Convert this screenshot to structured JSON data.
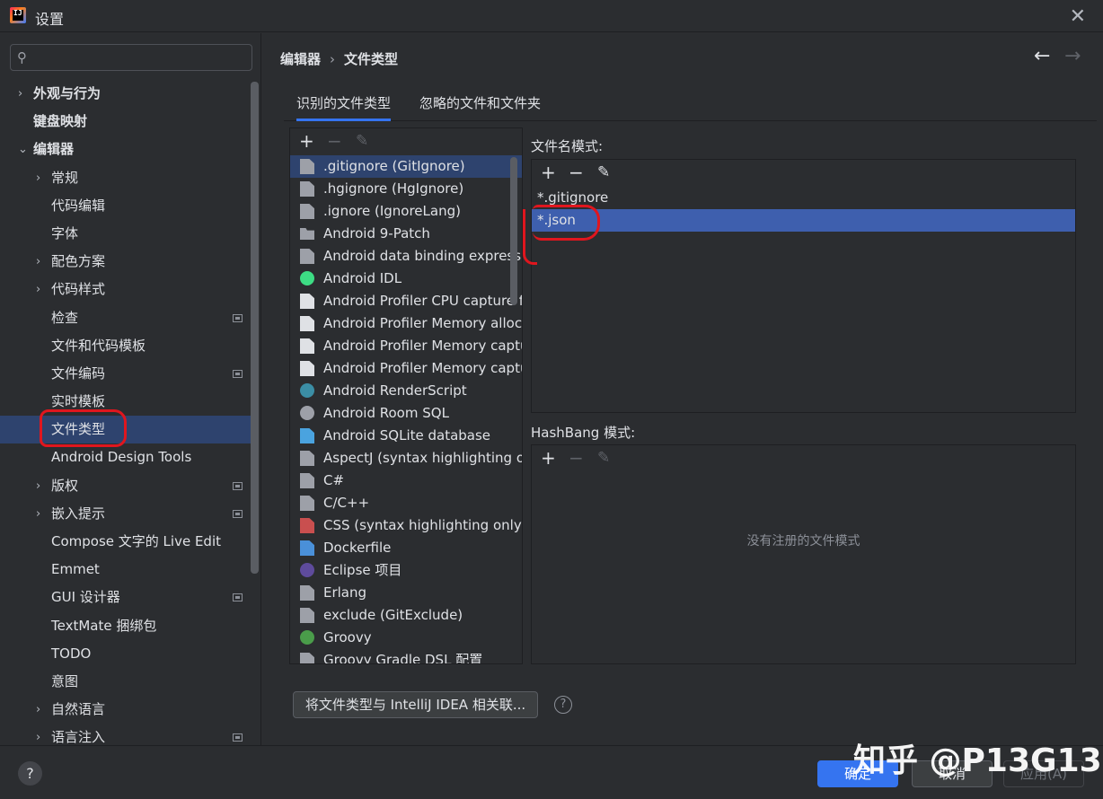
{
  "window": {
    "title": "设置",
    "app_icon": "intellij-icon"
  },
  "search": {
    "placeholder": ""
  },
  "sidebar": {
    "items": [
      {
        "label": "外观与行为",
        "level": 0,
        "chevron": "›",
        "bold": true
      },
      {
        "label": "键盘映射",
        "level": 0,
        "chevron": "",
        "bold": true
      },
      {
        "label": "编辑器",
        "level": 0,
        "chevron": "⌄",
        "bold": true
      },
      {
        "label": "常规",
        "level": 1,
        "chevron": "›"
      },
      {
        "label": "代码编辑",
        "level": 1,
        "chevron": ""
      },
      {
        "label": "字体",
        "level": 1,
        "chevron": ""
      },
      {
        "label": "配色方案",
        "level": 1,
        "chevron": "›"
      },
      {
        "label": "代码样式",
        "level": 1,
        "chevron": "›"
      },
      {
        "label": "检查",
        "level": 1,
        "chevron": "",
        "badge": true
      },
      {
        "label": "文件和代码模板",
        "level": 1,
        "chevron": ""
      },
      {
        "label": "文件编码",
        "level": 1,
        "chevron": "",
        "badge": true
      },
      {
        "label": "实时模板",
        "level": 1,
        "chevron": ""
      },
      {
        "label": "文件类型",
        "level": 1,
        "chevron": "",
        "selected": true
      },
      {
        "label": "Android Design Tools",
        "level": 1,
        "chevron": ""
      },
      {
        "label": "版权",
        "level": 1,
        "chevron": "›",
        "badge": true
      },
      {
        "label": "嵌入提示",
        "level": 1,
        "chevron": "›",
        "badge": true
      },
      {
        "label": "Compose 文字的 Live Edit",
        "level": 1,
        "chevron": ""
      },
      {
        "label": "Emmet",
        "level": 1,
        "chevron": ""
      },
      {
        "label": "GUI 设计器",
        "level": 1,
        "chevron": "",
        "badge": true
      },
      {
        "label": "TextMate 捆绑包",
        "level": 1,
        "chevron": ""
      },
      {
        "label": "TODO",
        "level": 1,
        "chevron": ""
      },
      {
        "label": "意图",
        "level": 1,
        "chevron": ""
      },
      {
        "label": "自然语言",
        "level": 1,
        "chevron": "›"
      },
      {
        "label": "语言注入",
        "level": 1,
        "chevron": "›",
        "badge": true
      }
    ]
  },
  "breadcrumb": {
    "parent": "编辑器",
    "separator": "›",
    "current": "文件类型"
  },
  "nav": {
    "back": "←",
    "forward": "→"
  },
  "tabs": [
    {
      "label": "识别的文件类型",
      "active": true
    },
    {
      "label": "忽略的文件和文件夹",
      "active": false
    }
  ],
  "toolbar": {
    "add": "+",
    "remove": "−",
    "edit": "✎"
  },
  "file_types": [
    {
      "name": ".gitignore (GitIgnore)",
      "icon": "file-icon",
      "ic": "file",
      "selected": true
    },
    {
      "name": ".hgignore (HgIgnore)",
      "icon": "file-icon",
      "ic": "file"
    },
    {
      "name": ".ignore (IgnoreLang)",
      "icon": "file-icon",
      "ic": "file"
    },
    {
      "name": "Android 9-Patch",
      "icon": "folder-icon",
      "ic": "folder"
    },
    {
      "name": "Android data binding expressio",
      "icon": "file-icon",
      "ic": "file"
    },
    {
      "name": "Android IDL",
      "icon": "android-icon",
      "ic": "round",
      "color": "#3ddc84"
    },
    {
      "name": "Android Profiler CPU capture fi",
      "icon": "profiler-file-icon",
      "ic": "fileb"
    },
    {
      "name": "Android Profiler Memory alloc",
      "icon": "profiler-file-icon",
      "ic": "fileb"
    },
    {
      "name": "Android Profiler Memory captu",
      "icon": "profiler-file-icon",
      "ic": "fileb"
    },
    {
      "name": "Android Profiler Memory captu",
      "icon": "profiler-file-icon",
      "ic": "fileb"
    },
    {
      "name": "Android RenderScript",
      "icon": "renderscript-icon",
      "ic": "round",
      "color": "#3b8ea5"
    },
    {
      "name": "Android Room SQL",
      "icon": "database-icon",
      "ic": "round",
      "color": "#9da0a8"
    },
    {
      "name": "Android SQLite database",
      "icon": "sqlite-icon",
      "ic": "fileb",
      "color": "#4aa3df"
    },
    {
      "name": "AspectJ (syntax highlighting or",
      "icon": "file-icon",
      "ic": "file"
    },
    {
      "name": "C#",
      "icon": "file-icon",
      "ic": "file"
    },
    {
      "name": "C/C++",
      "icon": "file-icon",
      "ic": "file"
    },
    {
      "name": "CSS (syntax highlighting only)",
      "icon": "css-icon",
      "ic": "fileb",
      "color": "#c94f4f"
    },
    {
      "name": "Dockerfile",
      "icon": "docker-file-icon",
      "ic": "fileb",
      "color": "#4a90d9"
    },
    {
      "name": "Eclipse 项目",
      "icon": "eclipse-icon",
      "ic": "round",
      "color": "#5e4b9c"
    },
    {
      "name": "Erlang",
      "icon": "file-icon",
      "ic": "file"
    },
    {
      "name": "exclude (GitExclude)",
      "icon": "file-icon",
      "ic": "file"
    },
    {
      "name": "Groovy",
      "icon": "groovy-icon",
      "ic": "round",
      "color": "#4a9c4a"
    },
    {
      "name": "Groovy Gradle DSL 配置",
      "icon": "gradle-icon",
      "ic": "file"
    }
  ],
  "file_name_patterns": {
    "label": "文件名模式:",
    "items": [
      {
        "value": "*.gitignore",
        "selected": false
      },
      {
        "value": "*.json",
        "selected": true
      }
    ]
  },
  "hashbang_patterns": {
    "label": "HashBang 模式:",
    "empty_text": "没有注册的文件模式"
  },
  "associate_button": "将文件类型与 IntelliJ IDEA 相关联...",
  "help_hint": "?",
  "footer": {
    "help": "?",
    "ok": "确定",
    "cancel": "取消",
    "apply": "应用(A)"
  },
  "watermark": "知乎 @P13G13"
}
